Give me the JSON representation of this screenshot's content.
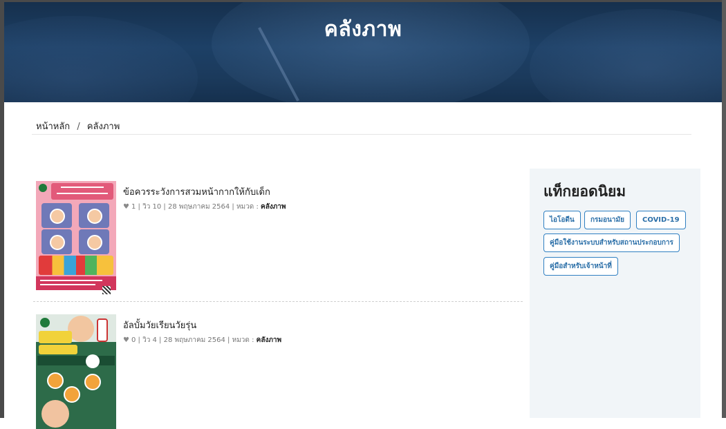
{
  "header": {
    "title": "คลังภาพ"
  },
  "breadcrumb": {
    "home": "หน้าหลัก",
    "separator": "/",
    "current": "คลังภาพ"
  },
  "posts": [
    {
      "title": "ข้อควรระวังการสวมหน้ากากให้กับเด็ก",
      "likes": "1",
      "views_label": "วิว",
      "views": "10",
      "date": "28 พฤษภาคม 2564",
      "category_label": "หมวด :",
      "category": "คลังภาพ"
    },
    {
      "title": "อัลบั้มวัยเรียนวัยรุ่น",
      "likes": "0",
      "views_label": "วิว",
      "views": "4",
      "date": "28 พฤษภาคม 2564",
      "category_label": "หมวด :",
      "category": "คลังภาพ"
    }
  ],
  "sidebar": {
    "title": "แท็กยอดนิยม",
    "tags": [
      "ไอโอดีน",
      "กรมอนามัย",
      "COVID-19",
      "คู่มือใช้งานระบบสำหรับสถานประกอบการ",
      "คู่มือสำหรับเจ้าหน้าที่"
    ]
  },
  "icons": {
    "like": "heart-icon"
  },
  "colors": {
    "header_bg": "#1d4066",
    "tag_border": "#2f7fc1",
    "tag_text": "#2b6fa8",
    "sidebar_bg": "#f1f5f8"
  }
}
